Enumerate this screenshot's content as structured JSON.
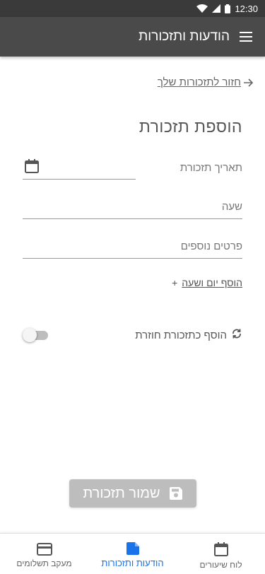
{
  "status_bar": {
    "time": "12:30"
  },
  "app_bar": {
    "title": "הודעות ותזכורות"
  },
  "back_link": {
    "label": "חזור לתזכורות שלך"
  },
  "form": {
    "title": "הוספת תזכורת",
    "date_label": "תאריך תזכורת",
    "time_label": "שעה",
    "details_label": "פרטים נוספים",
    "add_day_time": "הוסף יום ושעה",
    "add_day_time_prefix": "+",
    "recurring_label": "הוסף כתזכורת חוזרת",
    "recurring_enabled": false
  },
  "save_button": {
    "label": "שמור תזכורת"
  },
  "bottom_nav": {
    "items": [
      {
        "label": "מעקב תשלומים",
        "icon": "credit-card-icon",
        "active": false
      },
      {
        "label": "הודעות ותזכורות",
        "icon": "document-icon",
        "active": true
      },
      {
        "label": "לוח שיעורים",
        "icon": "calendar-icon",
        "active": false
      }
    ]
  },
  "colors": {
    "status_bar": "#3a3a3a",
    "app_bar": "#4a4a4a",
    "accent": "#1a73e8",
    "save_button_disabled": "#bdbdbd"
  }
}
